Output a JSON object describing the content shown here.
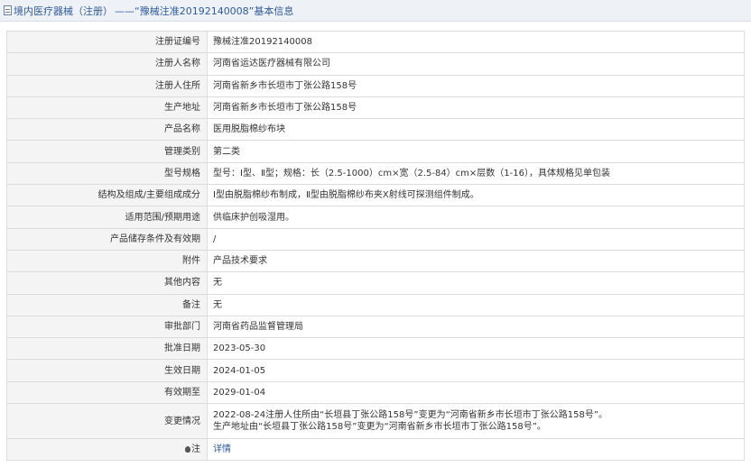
{
  "header": {
    "link_text": "境内医疗器械（注册）",
    "title": "——“豫械注准20192140008”基本信息"
  },
  "rows": [
    {
      "label": "注册证编号",
      "value": "豫械注准20192140008"
    },
    {
      "label": "注册人名称",
      "value": "河南省运达医疗器械有限公司"
    },
    {
      "label": "注册人住所",
      "value": "河南省新乡市长垣市丁张公路158号"
    },
    {
      "label": "生产地址",
      "value": "河南省新乡市长垣市丁张公路158号"
    },
    {
      "label": "产品名称",
      "value": "医用脱脂棉纱布块"
    },
    {
      "label": "管理类别",
      "value": "第二类"
    },
    {
      "label": "型号规格",
      "value": "型号：Ⅰ型、Ⅱ型；规格：长（2.5-1000）cm×宽（2.5-84）cm×层数（1-16），具体规格见单包装"
    },
    {
      "label": "结构及组成/主要组成成分",
      "value": "Ⅰ型由脱脂棉纱布制成，Ⅱ型由脱脂棉纱布夹X射线可探测组件制成。"
    },
    {
      "label": "适用范围/预期用途",
      "value": "供临床护创吸湿用。"
    },
    {
      "label": "产品储存条件及有效期",
      "value": "/"
    },
    {
      "label": "附件",
      "value": "产品技术要求"
    },
    {
      "label": "其他内容",
      "value": "无"
    },
    {
      "label": "备注",
      "value": "无"
    },
    {
      "label": "审批部门",
      "value": "河南省药品监督管理局"
    },
    {
      "label": "批准日期",
      "value": "2023-05-30"
    },
    {
      "label": "生效日期",
      "value": "2024-01-05"
    },
    {
      "label": "有效期至",
      "value": "2029-01-04"
    }
  ],
  "change": {
    "label": "变更情况",
    "line1": "2022-08-24注册人住所由“长垣县丁张公路158号”变更为“河南省新乡市长垣市丁张公路158号”。",
    "line2": "生产地址由“长垣县丁张公路158号”变更为“河南省新乡市长垣市丁张公路158号”。"
  },
  "note": {
    "label": "注",
    "icon": "bulb-icon",
    "link_text": "详情"
  }
}
